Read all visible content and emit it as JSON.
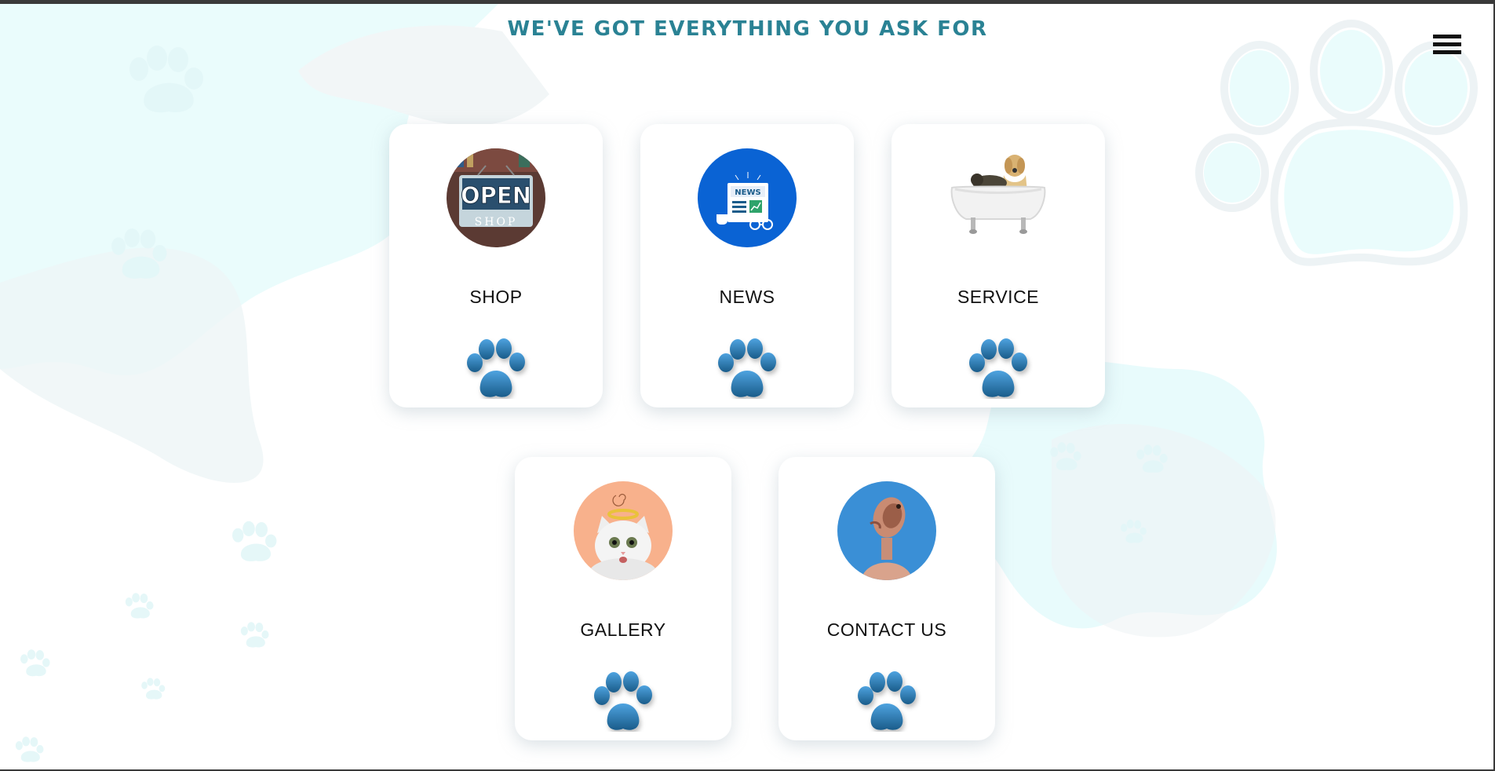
{
  "header": {
    "title": "WE'VE GOT EVERYTHING YOU ASK FOR",
    "menu_icon": "hamburger-menu-icon"
  },
  "cards": [
    {
      "label": "SHOP",
      "image": "open-shop-sign-image",
      "paw_icon": "paw-icon"
    },
    {
      "label": "NEWS",
      "image": "newspaper-news-image",
      "paw_icon": "paw-icon"
    },
    {
      "label": "SERVICE",
      "image": "dog-cat-bathtub-image",
      "paw_icon": "paw-icon"
    },
    {
      "label": "GALLERY",
      "image": "cat-with-halo-image",
      "paw_icon": "paw-icon"
    },
    {
      "label": "CONTACT US",
      "image": "dog-on-phone-image",
      "paw_icon": "paw-icon"
    }
  ],
  "colors": {
    "title": "#2a8294",
    "paw_light": "#4ea3e0",
    "paw_dark": "#1a5c8a",
    "news_bg": "#0a63d4",
    "contact_bg": "#3a8fd6",
    "gallery_bg": "#f8b18c",
    "background_blob": "#e7fbfb"
  }
}
